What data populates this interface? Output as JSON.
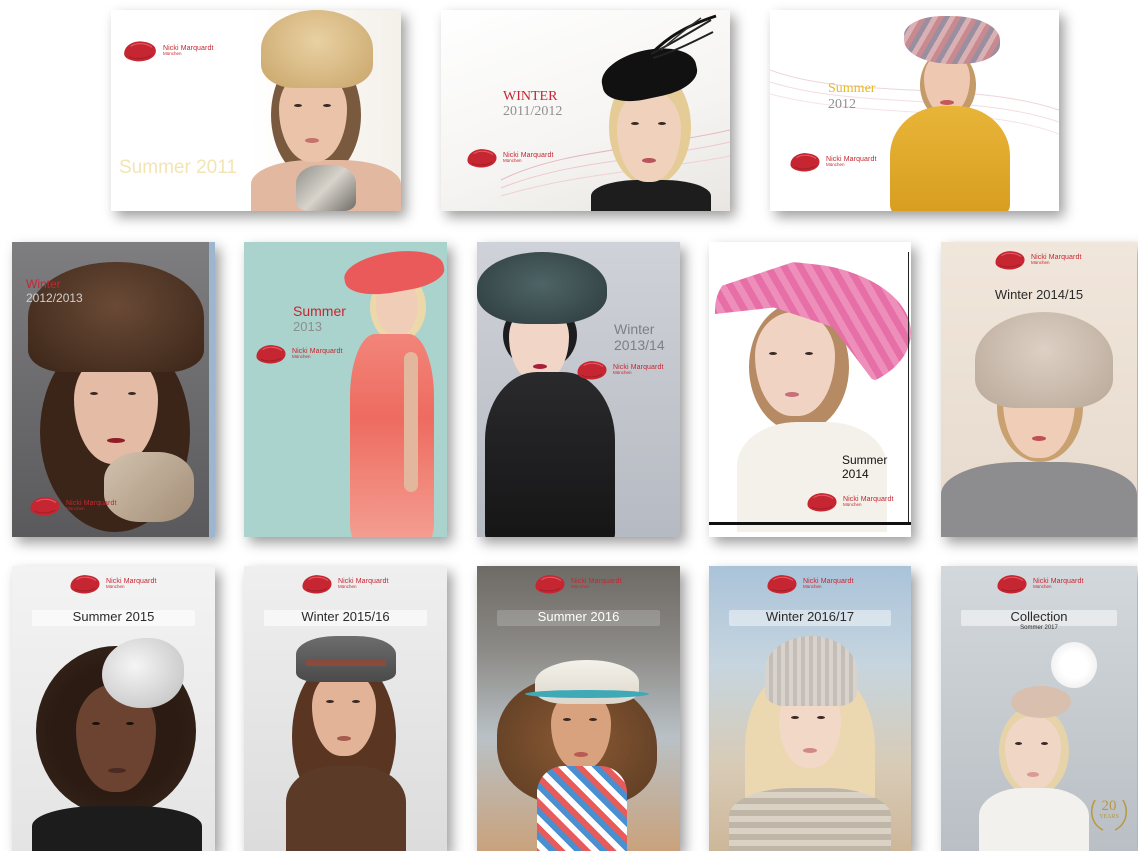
{
  "catalogs": [
    {
      "id": "summer-2011",
      "title": "Summer 2011",
      "logo_name": "Nicki Marquardt",
      "logo_city": "München"
    },
    {
      "id": "winter-2011",
      "title_line1": "WINTER",
      "title_line2": "2011/2012",
      "logo_name": "Nicki Marquardt",
      "logo_city": "München"
    },
    {
      "id": "summer-2012",
      "title_line1": "Summer",
      "title_line2": "2012",
      "logo_name": "Nicki Marquardt",
      "logo_city": "München"
    },
    {
      "id": "winter-2012",
      "title_line1": "Winter",
      "title_line2": "2012/2013",
      "logo_name": "Nicki Marquardt",
      "logo_city": "München"
    },
    {
      "id": "summer-2013",
      "title_line1": "Summer",
      "title_line2": "2013",
      "logo_name": "Nicki Marquardt",
      "logo_city": "München"
    },
    {
      "id": "winter-2013",
      "title_line1": "Winter",
      "title_line2": "2013/14",
      "logo_name": "Nicki Marquardt",
      "logo_city": "München"
    },
    {
      "id": "summer-2014",
      "title_line1": "Summer",
      "title_line2": "2014",
      "logo_name": "Nicki Marquardt",
      "logo_city": "München"
    },
    {
      "id": "winter-2014",
      "title": "Winter 2014/15",
      "logo_name": "Nicki Marquardt",
      "logo_city": "München"
    },
    {
      "id": "summer-2015",
      "title": "Summer 2015",
      "logo_name": "Nicki Marquardt",
      "logo_city": "München"
    },
    {
      "id": "winter-2015",
      "title": "Winter 2015/16",
      "logo_name": "Nicki Marquardt",
      "logo_city": "München"
    },
    {
      "id": "summer-2016",
      "title": "Summer 2016",
      "logo_name": "Nicki Marquardt",
      "logo_city": "München"
    },
    {
      "id": "winter-2016",
      "title": "Winter 2016/17",
      "logo_name": "Nicki Marquardt",
      "logo_city": "München"
    },
    {
      "id": "collection-2017",
      "title": "Collection",
      "subtitle": "Sommer 2017",
      "logo_name": "Nicki Marquardt",
      "logo_city": "München",
      "badge_number": "20",
      "badge_text": "YEARS"
    }
  ],
  "colors": {
    "brand_red": "#c62631",
    "title_gray": "#8f8f8f",
    "summer_gold": "#e7b82a",
    "summer2011_cream": "#f3e4b3"
  },
  "icons": {
    "logo": "rose-petal-logo-icon"
  }
}
